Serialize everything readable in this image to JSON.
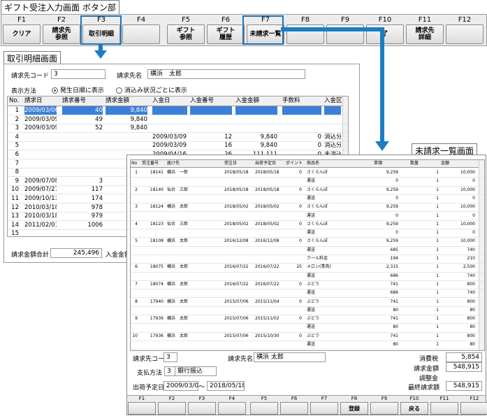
{
  "captions": {
    "button_section": "ギフト受注入力画面 ボタン部",
    "detail_screen": "取引明細画面",
    "unbilled_screen": "未請求一覧画面"
  },
  "fkeys": [
    {
      "fn": "F1",
      "label": "クリア"
    },
    {
      "fn": "F2",
      "label": "請求先\n参照"
    },
    {
      "fn": "F3",
      "label": "取引明細"
    },
    {
      "fn": "F4",
      "label": ""
    },
    {
      "fn": "F5",
      "label": "ギフト\n参照"
    },
    {
      "fn": "F6",
      "label": "ギフト\n履歴"
    },
    {
      "fn": "F7",
      "label": "未請求一覧"
    },
    {
      "fn": "F8",
      "label": ""
    },
    {
      "fn": "F9",
      "label": ""
    },
    {
      "fn": "F10",
      "label": "了"
    },
    {
      "fn": "F11",
      "label": "請求先\n詳細"
    },
    {
      "fn": "F12",
      "label": ""
    }
  ],
  "detail": {
    "code_label": "請求先コード",
    "code_value": "3",
    "name_label": "請求先名",
    "name_value": "横浜　太郎",
    "display_label": "表示方法",
    "radio1": "発生日順に表示",
    "radio2": "消込み状況ごとに表示",
    "columns": [
      "No.",
      "請求日",
      "請求番号",
      "請求金額",
      "入金日",
      "入金番号",
      "入金金額",
      "手数料",
      "入金区"
    ],
    "rows": [
      [
        "1",
        "2009/03/06",
        "40",
        "9,840",
        "",
        "",
        "",
        "",
        ""
      ],
      [
        "2",
        "2009/03/09",
        "49",
        "9,840",
        "",
        "",
        "",
        "",
        ""
      ],
      [
        "3",
        "2009/03/09",
        "52",
        "9,840",
        "",
        "",
        "",
        "",
        ""
      ],
      [
        "4",
        "",
        "",
        "",
        "2009/03/09",
        "12",
        "9,840",
        "0",
        "消込分"
      ],
      [
        "5",
        "",
        "",
        "",
        "2009/03/09",
        "16",
        "9,840",
        "0",
        "消込分"
      ],
      [
        "6",
        "",
        "",
        "",
        "2009/04/16",
        "26",
        "111,111",
        "0",
        "未消込"
      ],
      [
        "7",
        "",
        "",
        "",
        "",
        "",
        "",
        "",
        ""
      ],
      [
        "8",
        "",
        "",
        "",
        "",
        "",
        "",
        "",
        ""
      ],
      [
        "9",
        "2009/07/08",
        "3",
        "",
        "",
        "",
        "",
        "",
        ""
      ],
      [
        "10",
        "2009/07/27",
        "117",
        "",
        "",
        "",
        "",
        "",
        ""
      ],
      [
        "11",
        "2009/10/13",
        "174",
        "",
        "",
        "",
        "",
        "",
        ""
      ],
      [
        "12",
        "2010/03/18",
        "978",
        "",
        "",
        "",
        "",
        "",
        ""
      ],
      [
        "13",
        "2010/03/18",
        "979",
        "",
        "",
        "",
        "",
        "",
        ""
      ],
      [
        "14",
        "2011/02/01",
        "1006",
        "",
        "",
        "",
        "",
        "",
        ""
      ],
      [
        "15",
        "",
        "",
        "",
        "",
        "",
        "",
        "",
        ""
      ]
    ],
    "total_label": "請求金額合計",
    "total_value": "245,496",
    "paid_label": "入金金額"
  },
  "unbilled": {
    "columns": [
      "No",
      "受注番号",
      "届け先",
      "受注日",
      "出荷予定日",
      "ポイント",
      "商品名",
      "単価",
      "数量",
      "金額"
    ],
    "rows": [
      [
        "1",
        "18141",
        "横浜　一郎",
        "2018/05/18",
        "2018/05/18",
        "0",
        "さくらんぼ",
        "9,259",
        "1",
        "10,000"
      ],
      [
        "",
        "",
        "",
        "",
        "",
        "",
        "運送",
        "0",
        "1",
        "0"
      ],
      [
        "2",
        "18140",
        "仙台　三郎",
        "2018/05/18",
        "2018/05/18",
        "0",
        "さくらんぼ",
        "9,259",
        "1",
        "10,000"
      ],
      [
        "",
        "",
        "",
        "",
        "",
        "",
        "運送",
        "0",
        "1",
        "0"
      ],
      [
        "3",
        "18124",
        "横浜　太郎",
        "2018/05/02",
        "2018/05/02",
        "0",
        "さくらんぼ",
        "9,259",
        "1",
        "10,000"
      ],
      [
        "",
        "",
        "",
        "",
        "",
        "",
        "運送",
        "0",
        "1",
        "0"
      ],
      [
        "4",
        "18123",
        "仙台　三郎",
        "2018/05/02",
        "2018/05/02",
        "0",
        "さくらんぼ",
        "9,259",
        "1",
        "10,000"
      ],
      [
        "",
        "",
        "",
        "",
        "",
        "",
        "運送",
        "0",
        "1",
        "0"
      ],
      [
        "5",
        "18108",
        "横浜　太郎",
        "2016/12/08",
        "2016/12/08",
        "0",
        "さくらんぼ",
        "9,259",
        "1",
        "10,000"
      ],
      [
        "",
        "",
        "",
        "",
        "",
        "",
        "運送",
        "685",
        "1",
        "740"
      ],
      [
        "",
        "",
        "",
        "",
        "",
        "",
        "クール料金",
        "194",
        "1",
        "210"
      ],
      [
        "6",
        "18075",
        "横浜　太郎",
        "2016/07/22",
        "2016/07/22",
        "25",
        "メロン(青肉)",
        "2,315",
        "1",
        "2,500"
      ],
      [
        "",
        "",
        "",
        "",
        "",
        "",
        "運送",
        "686",
        "1",
        "740"
      ],
      [
        "7",
        "18074",
        "横浜　太郎",
        "2016/07/22",
        "2016/07/22",
        "0",
        "ぶどう",
        "741",
        "1",
        "800"
      ],
      [
        "",
        "",
        "",
        "",
        "",
        "",
        "運送",
        "686",
        "1",
        "740"
      ],
      [
        "8",
        "17940",
        "横浜　太郎",
        "2015/07/06",
        "2015/11/04",
        "0",
        "ぶどう",
        "741",
        "1",
        "800"
      ],
      [
        "",
        "",
        "",
        "",
        "",
        "",
        "運送",
        "80",
        "1",
        "80"
      ],
      [
        "9",
        "17939",
        "横浜　太郎",
        "2015/07/06",
        "2015/11/02",
        "0",
        "ぶどう",
        "741",
        "1",
        "800"
      ],
      [
        "",
        "",
        "",
        "",
        "",
        "",
        "運送",
        "80",
        "1",
        "80"
      ],
      [
        "10",
        "17936",
        "横浜　太郎",
        "2015/07/06",
        "2015/10/30",
        "0",
        "ぶどう",
        "741",
        "1",
        "800"
      ],
      [
        "",
        "",
        "",
        "",
        "",
        "",
        "運送",
        "80",
        "1",
        "80"
      ]
    ],
    "code_label": "請求先コード",
    "code_value": "3",
    "name_label": "請求先名",
    "name_value": "横浜 太郎",
    "pay_label": "支払方法",
    "pay_code": "3",
    "pay_value": "銀行振込",
    "ship_label": "出荷予定日",
    "ship_from": "2009/03/03",
    "ship_sep": "～",
    "ship_to": "2018/05/18",
    "tax_label": "消費税",
    "tax_value": "5,854",
    "bill_label": "請求金額",
    "bill_value": "548,915",
    "adjust_label": "調整金",
    "final_label": "最終請求額",
    "final_value": "548,915",
    "fkeys": [
      {
        "fn": "F1",
        "label": ""
      },
      {
        "fn": "F2",
        "label": ""
      },
      {
        "fn": "F3",
        "label": ""
      },
      {
        "fn": "F4",
        "label": ""
      },
      {
        "fn": "F5",
        "label": ""
      },
      {
        "fn": "F6",
        "label": ""
      },
      {
        "fn": "F7",
        "label": ""
      },
      {
        "fn": "F8",
        "label": "登録"
      },
      {
        "fn": "F9",
        "label": ""
      },
      {
        "fn": "F10",
        "label": "戻る"
      },
      {
        "fn": "F11",
        "label": ""
      },
      {
        "fn": "F12",
        "label": ""
      }
    ]
  },
  "colors": {
    "highlight": "#1f73b8",
    "arrow": "#1c7dc4",
    "selected_row": "#3c7fd9"
  }
}
